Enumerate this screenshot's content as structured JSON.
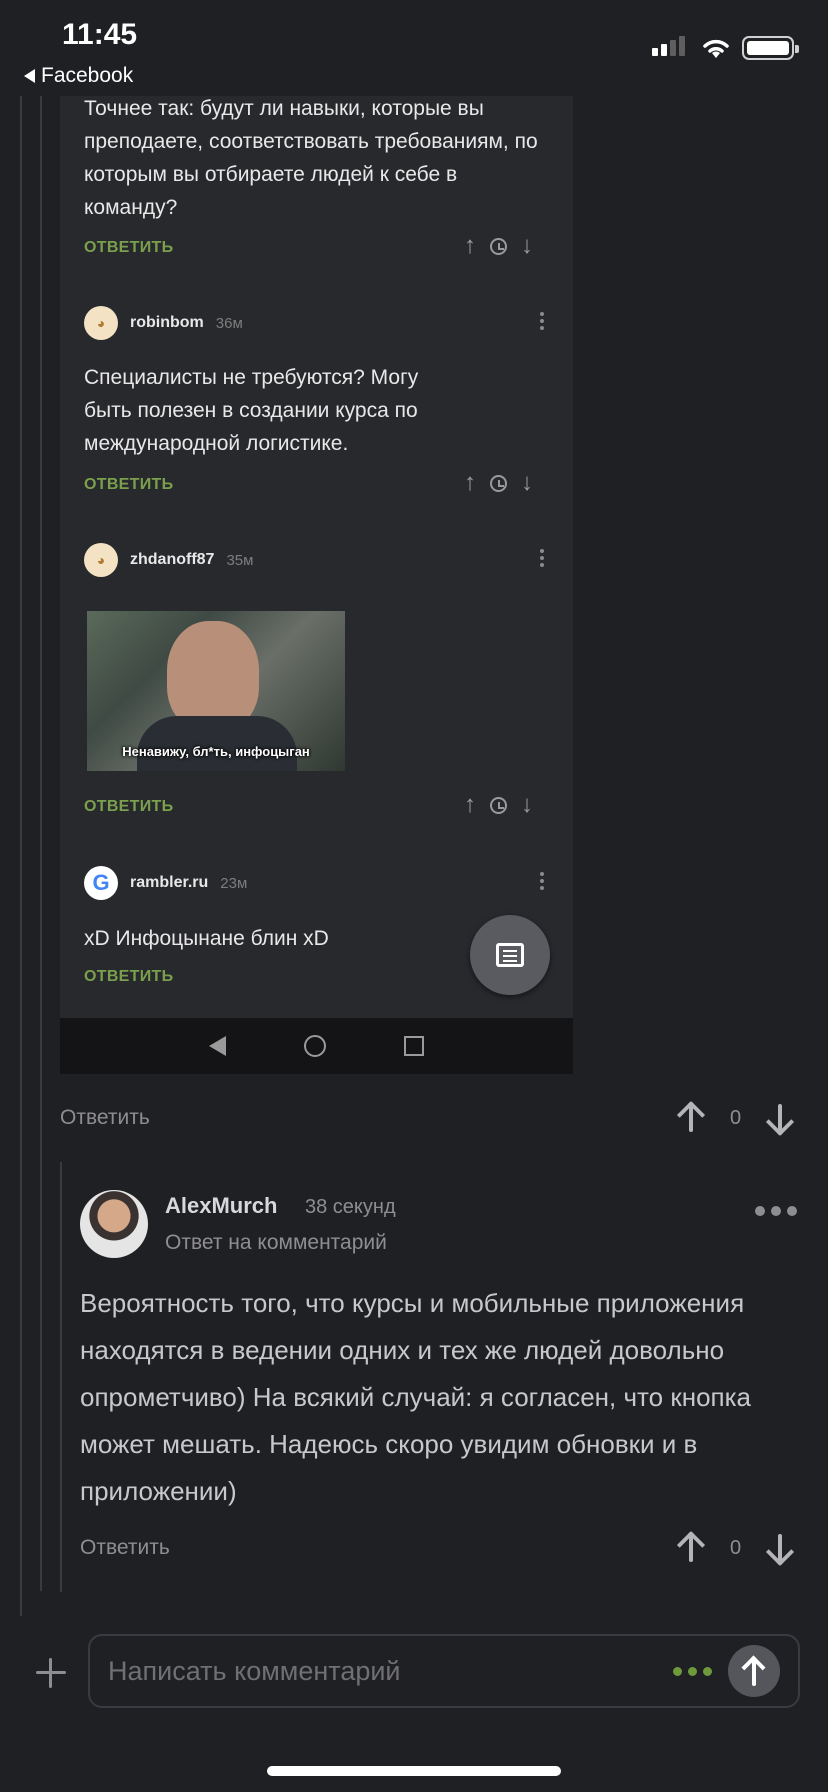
{
  "status_bar": {
    "time": "11:45",
    "back_label": "Facebook"
  },
  "embedded_screenshot": {
    "comments": [
      {
        "text": "Точнее так: будут ли навыки, которые вы преподаете, соответствовать требованиям, по которым вы отбираете людей к себе в команду?",
        "reply": "ОТВЕТИТЬ"
      },
      {
        "user": "robinbom",
        "time": "36м",
        "text": "Специалисты не требуются? Могу быть полезен в создании курса по международной логистике.",
        "reply": "ОТВЕТИТЬ"
      },
      {
        "user": "zhdanoff87",
        "time": "35м",
        "image_caption": "Ненавижу, бл*ть, инфоцыган",
        "reply": "ОТВЕТИТЬ"
      },
      {
        "user": "rambler.ru",
        "time": "23м",
        "text": "xD Инфоцынане блин xD",
        "reply": "ОТВЕТИТЬ"
      }
    ]
  },
  "post_comment": {
    "reply_label": "Ответить",
    "score": "0"
  },
  "reply_comment": {
    "author": "AlexMurch",
    "time": "38 секунд",
    "reply_to": "Ответ на комментарий",
    "text": "Вероятность того, что курсы и мобильные приложения находятся в ведении одних и тех же людей довольно опрометчиво) На всякий случай: я согласен, что кнопка может мешать. Надеюсь скоро увидим обновки и в приложении)",
    "reply_label": "Ответить",
    "score": "0"
  },
  "composer": {
    "placeholder": "Написать комментарий"
  }
}
